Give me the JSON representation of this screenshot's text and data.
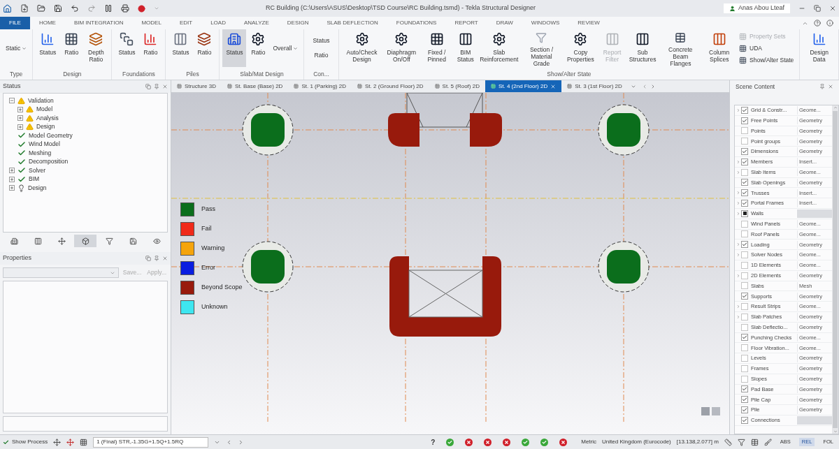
{
  "window": {
    "title": "RC Building (C:\\Users\\ASUS\\Desktop\\TSD Course\\RC Building.tsmd) - Tekla Structural Designer",
    "user": "Anas Abou Lteaf"
  },
  "menu": [
    {
      "label": "FILE",
      "selected": true
    },
    {
      "label": "HOME",
      "selected": false
    },
    {
      "label": "BIM INTEGRATION",
      "selected": false
    },
    {
      "label": "MODEL",
      "selected": false
    },
    {
      "label": "EDIT",
      "selected": false
    },
    {
      "label": "LOAD",
      "selected": false
    },
    {
      "label": "ANALYZE",
      "selected": false
    },
    {
      "label": "DESIGN",
      "selected": false
    },
    {
      "label": "SLAB DEFLECTION",
      "selected": false
    },
    {
      "label": "FOUNDATIONS",
      "selected": false
    },
    {
      "label": "REPORT",
      "selected": false
    },
    {
      "label": "DRAW",
      "selected": false
    },
    {
      "label": "WINDOWS",
      "selected": false
    },
    {
      "label": "REVIEW",
      "selected": false
    }
  ],
  "ribbon": [
    {
      "label": "Type",
      "buttons": [
        {
          "kind": "dropdown",
          "label": "Static",
          "selected": false,
          "disabled": false
        }
      ]
    },
    {
      "label": "Design",
      "buttons": [
        {
          "kind": "large",
          "label": "Status",
          "selected": false,
          "disabled": false
        },
        {
          "kind": "large",
          "label": "Ratio",
          "selected": false,
          "disabled": false
        },
        {
          "kind": "large",
          "label": "Depth Ratio",
          "selected": false,
          "disabled": false
        }
      ]
    },
    {
      "label": "Foundations",
      "buttons": [
        {
          "kind": "large",
          "label": "Status",
          "selected": false,
          "disabled": false
        },
        {
          "kind": "large",
          "label": "Ratio",
          "selected": false,
          "disabled": false
        }
      ]
    },
    {
      "label": "Piles",
      "buttons": [
        {
          "kind": "large",
          "label": "Status",
          "selected": false,
          "disabled": false
        },
        {
          "kind": "large",
          "label": "Ratio",
          "selected": false,
          "disabled": false
        }
      ]
    },
    {
      "label": "Slab/Mat Design",
      "buttons": [
        {
          "kind": "large",
          "label": "Status",
          "selected": true,
          "disabled": false
        },
        {
          "kind": "large",
          "label": "Ratio",
          "selected": false,
          "disabled": false
        },
        {
          "kind": "dropdown",
          "label": "Overall",
          "selected": false,
          "disabled": false
        }
      ]
    },
    {
      "label": "Con...",
      "buttons": [
        {
          "kind": "text",
          "label": "Status",
          "selected": false,
          "disabled": false
        },
        {
          "kind": "text",
          "label": "Ratio",
          "selected": false,
          "disabled": false
        }
      ]
    },
    {
      "label": "Show/Alter State",
      "buttons": [
        {
          "kind": "large",
          "label": "Auto/Check Design",
          "selected": false,
          "disabled": false
        },
        {
          "kind": "large",
          "label": "Diaphragm On/Off",
          "selected": false,
          "disabled": false
        },
        {
          "kind": "large",
          "label": "Fixed / Pinned",
          "selected": false,
          "disabled": false
        },
        {
          "kind": "large",
          "label": "BIM Status",
          "selected": false,
          "disabled": false
        },
        {
          "kind": "large",
          "label": "Slab Reinforcement",
          "selected": false,
          "disabled": false
        },
        {
          "kind": "large",
          "label": "Section / Material Grade",
          "selected": false,
          "disabled": false
        },
        {
          "kind": "large",
          "label": "Copy Properties",
          "selected": false,
          "disabled": false
        },
        {
          "kind": "large",
          "label": "Report Filter",
          "selected": false,
          "disabled": true
        },
        {
          "kind": "large",
          "label": "Sub Structures",
          "selected": false,
          "disabled": false
        },
        {
          "kind": "large",
          "label": "Concrete Beam Flanges",
          "selected": false,
          "disabled": false
        },
        {
          "kind": "large",
          "label": "Column Splices",
          "selected": false,
          "disabled": false
        },
        {
          "kind": "small",
          "label": "Property Sets",
          "selected": false,
          "disabled": true
        },
        {
          "kind": "small",
          "label": "UDA",
          "selected": false,
          "disabled": false
        },
        {
          "kind": "small",
          "label": "Show/Alter State",
          "selected": false,
          "disabled": false
        }
      ]
    },
    {
      "buttons": [
        {
          "kind": "large",
          "label": "Design Data",
          "selected": false,
          "disabled": false
        }
      ]
    }
  ],
  "view_tabs": [
    {
      "label": "Structure 3D",
      "selected": false
    },
    {
      "label": "St. Base (Base) 2D",
      "selected": false
    },
    {
      "label": "St. 1 (Parking) 2D",
      "selected": false
    },
    {
      "label": "St. 2 (Ground Floor) 2D",
      "selected": false
    },
    {
      "label": "St. 5 (Roof) 2D",
      "selected": false
    },
    {
      "label": "St. 4 (2nd Floor) 2D",
      "selected": true
    },
    {
      "label": "St. 3 (1st Floor) 2D",
      "selected": false
    }
  ],
  "status_panel": {
    "title": "Status",
    "tree": [
      {
        "label": "Validation",
        "kind": "warning",
        "expanded": true,
        "children": [
          {
            "label": "Model",
            "kind": "warning",
            "expanded": false
          },
          {
            "label": "Analysis",
            "kind": "warning",
            "expanded": false
          },
          {
            "label": "Design",
            "kind": "warning",
            "expanded": false
          }
        ]
      },
      {
        "label": "Model Geometry",
        "kind": "ok"
      },
      {
        "label": "Wind Model",
        "kind": "ok"
      },
      {
        "label": "Meshing",
        "kind": "ok"
      },
      {
        "label": "Decomposition",
        "kind": "ok"
      },
      {
        "label": "Solver",
        "kind": "ok",
        "expanded": false
      },
      {
        "label": "BIM",
        "kind": "ok",
        "expanded": false
      },
      {
        "label": "Design",
        "kind": "pending",
        "expanded": false
      }
    ],
    "tool_tabs": [
      {
        "selected": false
      },
      {
        "selected": false
      },
      {
        "selected": false
      },
      {
        "selected": true
      },
      {
        "selected": false
      },
      {
        "selected": false
      },
      {
        "selected": false
      }
    ]
  },
  "properties_panel": {
    "title": "Properties",
    "buttons": [
      "Save...",
      "Apply..."
    ]
  },
  "legend": [
    {
      "label": "Pass",
      "color": "#0b6e1c"
    },
    {
      "label": "Fail",
      "color": "#f02a1a"
    },
    {
      "label": "Warning",
      "color": "#f5a40c"
    },
    {
      "label": "Error",
      "color": "#0a1ee0"
    },
    {
      "label": "Beyond Scope",
      "color": "#981a0c"
    },
    {
      "label": "Unknown",
      "color": "#3ee6f0"
    }
  ],
  "scene_panel": {
    "title": "Scene Content",
    "rows": [
      {
        "name": "Grid & Constr...",
        "type": "Geome...",
        "checked": true,
        "partial": false,
        "expandable": true
      },
      {
        "name": "Free Points",
        "type": "Geometry",
        "checked": true,
        "partial": false,
        "expandable": false
      },
      {
        "name": "Points",
        "type": "Geometry",
        "checked": false,
        "partial": false,
        "expandable": false
      },
      {
        "name": "Point groups",
        "type": "Geometry",
        "checked": false,
        "partial": false,
        "expandable": false
      },
      {
        "name": "Dimensions",
        "type": "Geometry",
        "checked": true,
        "partial": false,
        "expandable": false
      },
      {
        "name": "Members",
        "type": "Insert...",
        "checked": true,
        "partial": false,
        "expandable": true
      },
      {
        "name": "Slab Items",
        "type": "Geome...",
        "checked": false,
        "partial": false,
        "expandable": true
      },
      {
        "name": "Slab Openings",
        "type": "Geometry",
        "checked": true,
        "partial": false,
        "expandable": false
      },
      {
        "name": "Trusses",
        "type": "Insert...",
        "checked": true,
        "partial": false,
        "expandable": true
      },
      {
        "name": "Portal Frames",
        "type": "Insert...",
        "checked": true,
        "partial": false,
        "expandable": true
      },
      {
        "name": "Walls",
        "checked": true,
        "partial": true,
        "expandable": true
      },
      {
        "name": "Wind Panels",
        "type": "Geome...",
        "checked": false,
        "partial": false,
        "expandable": false
      },
      {
        "name": "Roof Panels",
        "type": "Geome...",
        "checked": false,
        "partial": false,
        "expandable": false
      },
      {
        "name": "Loading",
        "type": "Geometry",
        "checked": true,
        "partial": false,
        "expandable": true
      },
      {
        "name": "Solver Nodes",
        "type": "Geome...",
        "checked": false,
        "partial": false,
        "expandable": true
      },
      {
        "name": "1D Elements",
        "type": "Geome...",
        "checked": false,
        "partial": false,
        "expandable": false
      },
      {
        "name": "2D Elements",
        "type": "Geometry",
        "checked": false,
        "partial": false,
        "expandable": true
      },
      {
        "name": "Slabs",
        "type": "Mesh",
        "checked": false,
        "partial": false,
        "expandable": false
      },
      {
        "name": "Supports",
        "type": "Geometry",
        "checked": true,
        "partial": false,
        "expandable": false
      },
      {
        "name": "Result Strips",
        "type": "Geome...",
        "checked": false,
        "partial": false,
        "expandable": true
      },
      {
        "name": "Slab Patches",
        "type": "Geometry",
        "checked": false,
        "partial": false,
        "expandable": true
      },
      {
        "name": "Slab Deflectio...",
        "type": "Geometry",
        "checked": false,
        "partial": false,
        "expandable": false
      },
      {
        "name": "Punching Checks",
        "type": "Geome...",
        "checked": true,
        "partial": false,
        "expandable": false
      },
      {
        "name": "Floor Vibration...",
        "type": "Geome...",
        "checked": false,
        "partial": false,
        "expandable": false
      },
      {
        "name": "Levels",
        "type": "Geometry",
        "checked": false,
        "partial": false,
        "expandable": false
      },
      {
        "name": "Frames",
        "type": "Geometry",
        "checked": false,
        "partial": false,
        "expandable": false
      },
      {
        "name": "Slopes",
        "type": "Geometry",
        "checked": false,
        "partial": false,
        "expandable": false
      },
      {
        "name": "Pad Base",
        "type": "Geometry",
        "checked": true,
        "partial": false,
        "expandable": false
      },
      {
        "name": "Pile Cap",
        "type": "Geometry",
        "checked": true,
        "partial": false,
        "expandable": false
      },
      {
        "name": "Pile",
        "type": "Geometry",
        "checked": true,
        "partial": false,
        "expandable": false
      },
      {
        "name": "Connections",
        "checked": true,
        "partial": false,
        "expandable": false
      }
    ]
  },
  "status_bar": {
    "show_process": {
      "label": "Show Process",
      "checked": true
    },
    "combination": "1 (Final) STR,-1.35G+1.5Q+1.5RQ",
    "help": "?",
    "checks": [
      {
        "kind": "pass"
      },
      {
        "kind": "fail"
      },
      {
        "kind": "fail"
      },
      {
        "kind": "fail"
      },
      {
        "kind": "pass"
      },
      {
        "kind": "pass"
      },
      {
        "kind": "fail"
      }
    ],
    "units": "Metric",
    "code": "United Kingdom (Eurocode)",
    "coordinates": "[13.138,2.077] m",
    "modes": [
      {
        "label": "ABS",
        "selected": false
      },
      {
        "label": "REL",
        "selected": true
      },
      {
        "label": "FOL",
        "selected": false
      }
    ]
  }
}
